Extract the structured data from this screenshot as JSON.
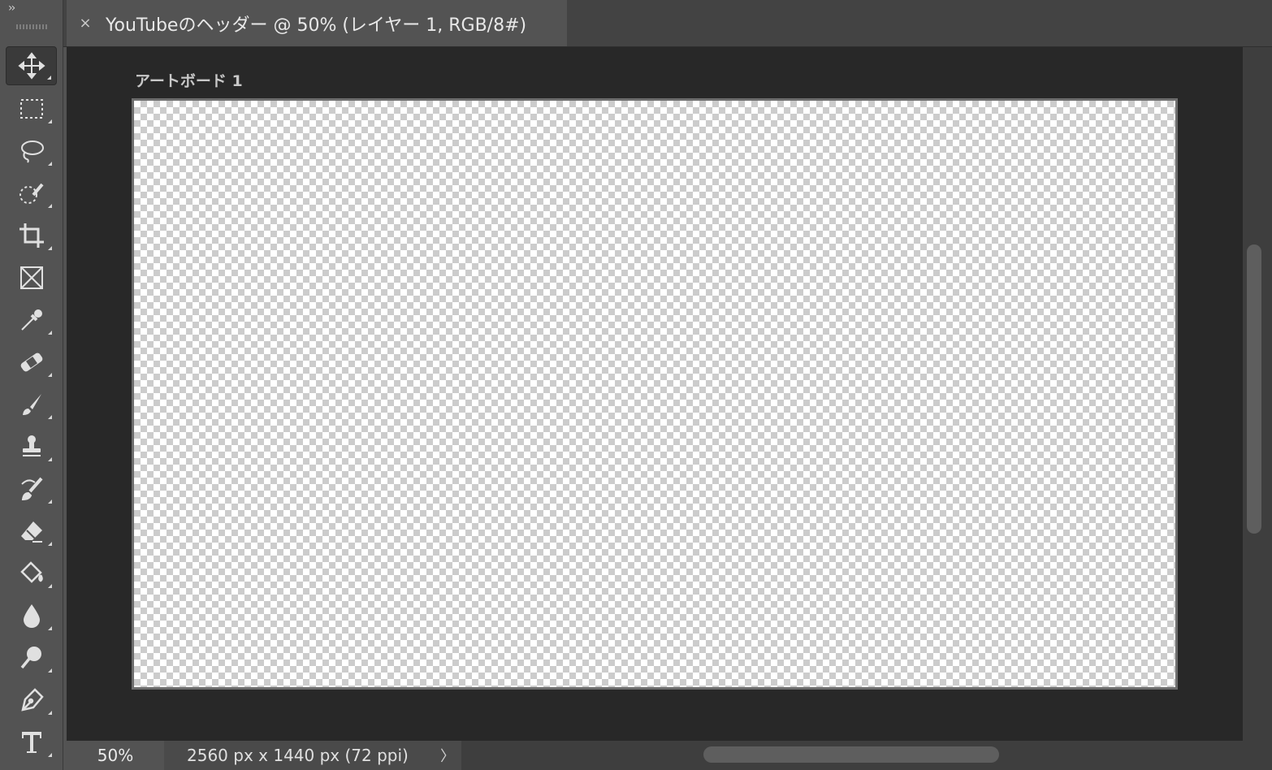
{
  "window": {
    "tab_title": "YouTubeのヘッダー @ 50% (レイヤー 1, RGB/8#)",
    "close_glyph": "×",
    "collapse_glyph": "››"
  },
  "toolbar": {
    "tools": [
      {
        "name": "move-tool",
        "icon": "move-icon",
        "active": true
      },
      {
        "name": "rectangular-marquee-tool",
        "icon": "marquee-icon"
      },
      {
        "name": "lasso-tool",
        "icon": "lasso-icon"
      },
      {
        "name": "quick-selection-tool",
        "icon": "quick-selection-icon"
      },
      {
        "name": "crop-tool",
        "icon": "crop-icon"
      },
      {
        "name": "frame-tool",
        "icon": "frame-icon"
      },
      {
        "name": "eyedropper-tool",
        "icon": "eyedropper-icon"
      },
      {
        "name": "healing-brush-tool",
        "icon": "bandage-icon"
      },
      {
        "name": "brush-tool",
        "icon": "brush-icon"
      },
      {
        "name": "clone-stamp-tool",
        "icon": "stamp-icon"
      },
      {
        "name": "history-brush-tool",
        "icon": "history-brush-icon"
      },
      {
        "name": "eraser-tool",
        "icon": "eraser-icon"
      },
      {
        "name": "paint-bucket-tool",
        "icon": "paint-bucket-icon"
      },
      {
        "name": "blur-tool",
        "icon": "droplet-icon"
      },
      {
        "name": "dodge-tool",
        "icon": "dodge-icon"
      },
      {
        "name": "pen-tool",
        "icon": "pen-icon"
      },
      {
        "name": "type-tool",
        "icon": "type-icon"
      }
    ]
  },
  "canvas": {
    "artboard_label": "アートボード 1"
  },
  "status": {
    "zoom": "50%",
    "doc_info": "2560 px x 1440 px (72 ppi)",
    "arrow_glyph": "〉"
  }
}
